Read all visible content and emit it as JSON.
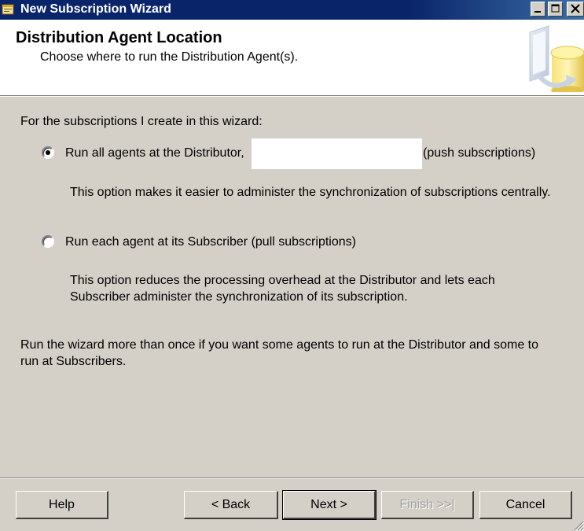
{
  "window": {
    "title": "New Subscription Wizard",
    "controls": {
      "minimize": "_",
      "maximize": "□",
      "close": "×"
    }
  },
  "header": {
    "title": "Distribution Agent Location",
    "subtitle": "Choose where to run the Distribution Agent(s)."
  },
  "body": {
    "intro": "For the subscriptions I create in this wizard:",
    "options": [
      {
        "label_prefix": "Run all agents at the Distributor,",
        "label_suffix": "(push subscriptions)",
        "selected": true,
        "description_lines": [
          "This option makes it easier to administer the synchronization of subscriptions centrally."
        ]
      },
      {
        "label": "Run each agent at its Subscriber (pull subscriptions)",
        "selected": false,
        "description_lines": [
          "This option reduces the processing overhead at the Distributor and lets each",
          "Subscriber administer the synchronization of its subscription."
        ]
      }
    ],
    "footer_lines": [
      "Run the wizard more than once if you want some agents to run at the Distributor and some to",
      "run at Subscribers."
    ]
  },
  "buttons": {
    "help": "Help",
    "back": "< Back",
    "next": "Next >",
    "finish": "Finish >>|",
    "cancel": "Cancel"
  },
  "colors": {
    "titlebar": "#0a246a",
    "dialog_bg": "#d4d0c8",
    "header_bg": "#ffffff"
  }
}
